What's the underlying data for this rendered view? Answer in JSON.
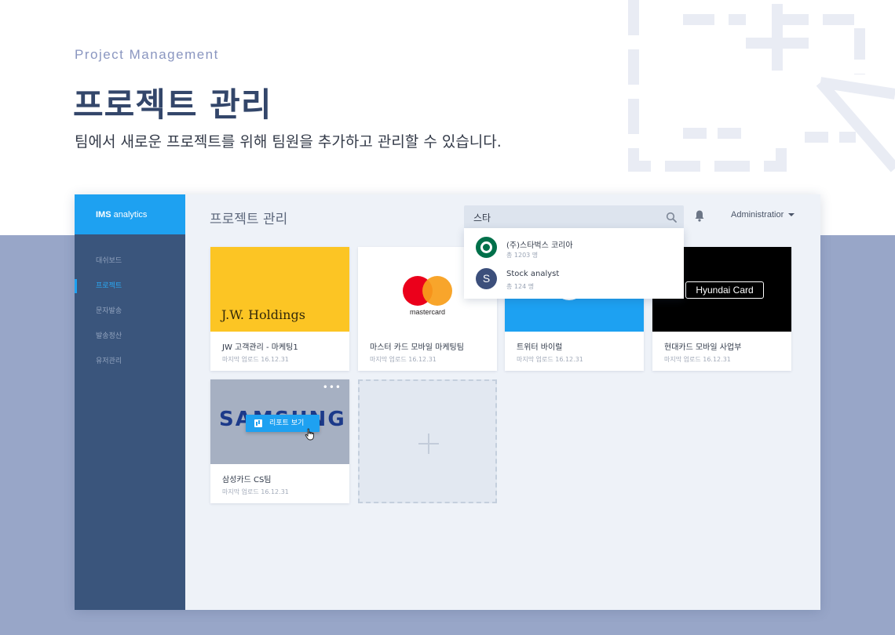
{
  "hero": {
    "subtitle": "Project Management",
    "title": "프로젝트 관리",
    "description": "팀에서 새로운 프로젝트를 위해 팀원을 추가하고 관리할 수 있습니다."
  },
  "app": {
    "brand_bold": "IMS",
    "brand_rest": " analytics",
    "page_title": "프로젝트 관리",
    "nav": [
      {
        "label": "대쉬보드",
        "active": false
      },
      {
        "label": "프로젝트",
        "active": true
      },
      {
        "label": "문자발송",
        "active": false
      },
      {
        "label": "발송정산",
        "active": false
      },
      {
        "label": "유저관리",
        "active": false
      }
    ],
    "search": {
      "value": "스타"
    },
    "user": {
      "name": "Administratior"
    },
    "search_results": [
      {
        "name": "(주)스타벅스 코리아",
        "count": "총 1203 명",
        "icon": "starbucks-logo"
      },
      {
        "name": "Stock analyst",
        "count": "총 124 명",
        "icon": "letter-avatar",
        "letter": "S"
      }
    ],
    "projects": [
      {
        "name": "JW 고객관리 - 마케팅1",
        "date": "마지막 업로드 16.12.31",
        "logo_text": "J.W. Holdings"
      },
      {
        "name": "마스터 카드 모바일 마케팅팀",
        "date": "마지막 업로드 16.12.31",
        "logo_text": "mastercard"
      },
      {
        "name": "트위터 바이럴",
        "date": "마지막 업로드 16.12.31",
        "logo_text": ""
      },
      {
        "name": "현대카드 모바일 사업부",
        "date": "마지막 업로드 16.12.31",
        "logo_text": "Hyundai Card"
      },
      {
        "name": "삼성카드 CS팀",
        "date": "마지막 업로드 16.12.31",
        "logo_text": "SAMSUNG"
      }
    ],
    "report_button": "리포트 보기",
    "more_label": "•••"
  },
  "colors": {
    "accent": "#1ea1f1",
    "sidebar": "#3a557c",
    "hero_title": "#33466a",
    "lower_background": "#98a6c8"
  }
}
